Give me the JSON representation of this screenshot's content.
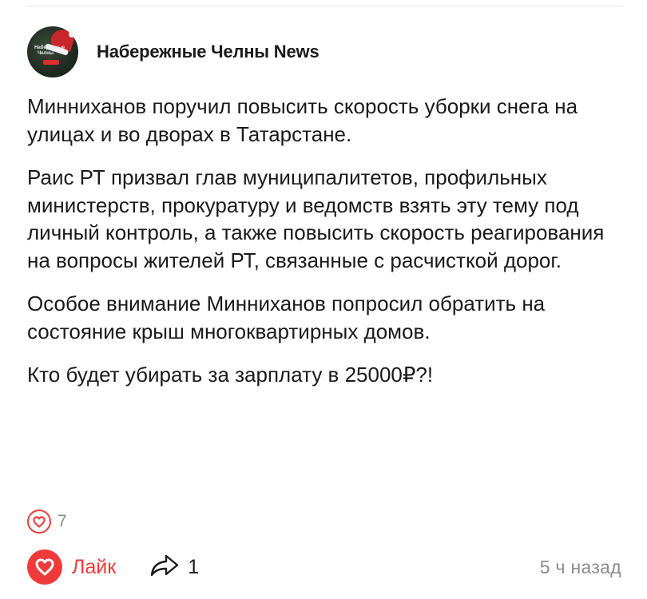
{
  "channel": {
    "name": "Набережные Челны News",
    "avatar_text": "Набережные Челны"
  },
  "post": {
    "paragraphs": [
      "Минниханов поручил повысить скорость уборки снега на улицах и во дворах в Татарстане.",
      "Раис РТ призвал глав муниципалитетов, профильных министерств, прокуратуру и ведомств взять эту тему под личный контроль, а также повысить скорость реагирования на вопросы жителей РТ, связанные с расчисткой дорог.",
      "Особое внимание Минниханов попросил обратить на состояние крыш многоквартирных домов.",
      "Кто будет убирать за зарплату в 25000₽?!"
    ]
  },
  "reactions": {
    "icon": "heart-icon",
    "count": "7"
  },
  "footer": {
    "like_label": "Лайк",
    "share_count": "1",
    "timestamp": "5 ч назад"
  },
  "colors": {
    "accent": "#ef3b3b",
    "text": "#1a1a1a",
    "muted": "#8a8a8a"
  }
}
